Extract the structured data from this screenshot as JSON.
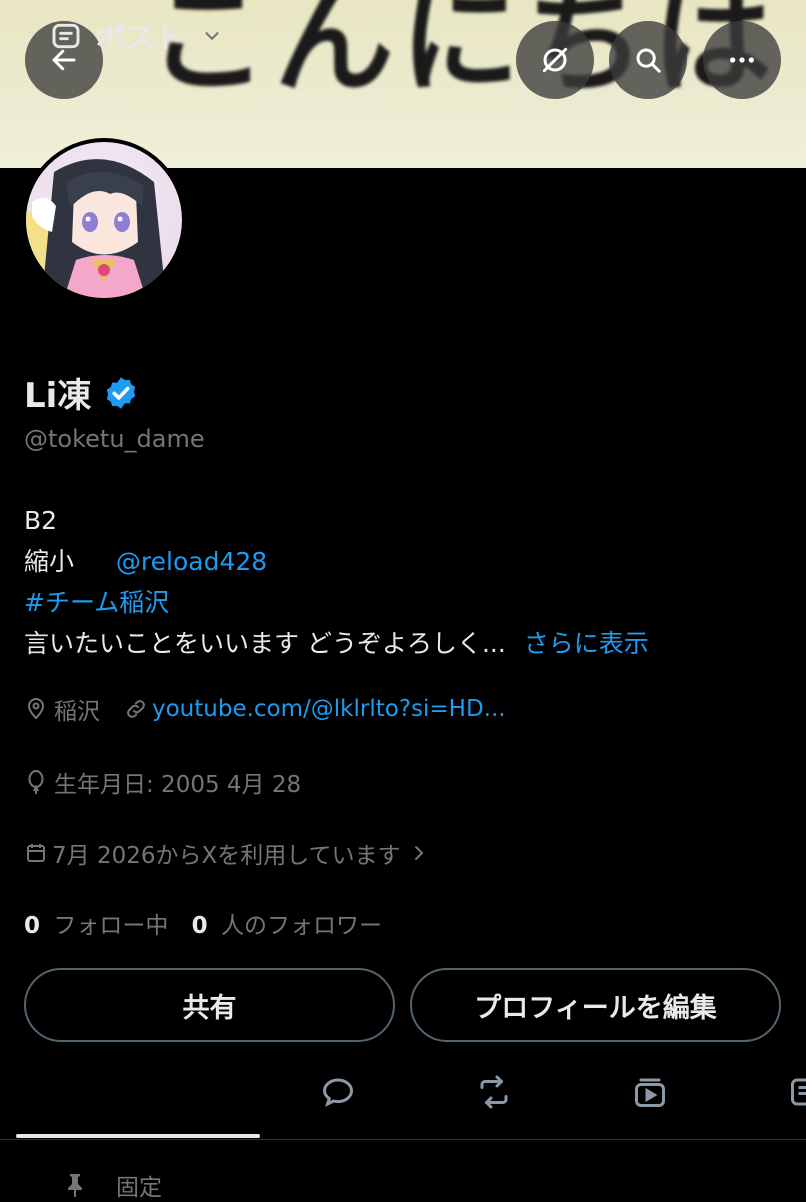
{
  "banner": {
    "text": "こんにちは",
    "bg_color": "#ecebd0"
  },
  "header_buttons": {
    "back_icon": "arrow-left-icon",
    "grok_icon": "grok-icon",
    "search_icon": "search-icon",
    "more_icon": "more-horizontal-icon"
  },
  "profile": {
    "name": "Li凍",
    "verified_icon": "verified-badge-icon",
    "handle": "@toketu_dame",
    "bio": {
      "line1": "B2",
      "line2_prefix": "縮小",
      "line2_mention": "@reload428",
      "hashtag": "#チーム稲沢",
      "line4_text": "言いたいことをいいます どうぞよろしく...",
      "show_more": "さらに表示"
    },
    "location": "稲沢",
    "link": "youtube.com/@lklrlto?si=HD...",
    "birthday": "生年月日: 2005 4月 28",
    "joined": "7月 2026からXを利用しています",
    "following_count": "0",
    "following_label": "フォロー中",
    "followers_count": "0",
    "followers_label": "人のフォロワー"
  },
  "actions": {
    "share": "共有",
    "edit_profile": "プロフィールを編集"
  },
  "tabs": {
    "active_label": "ポスト"
  },
  "pinned": {
    "label": "固定"
  },
  "colors": {
    "accent": "#1d9bf0",
    "text": "#e7e9ea",
    "muted": "#71767b",
    "background": "#000000"
  }
}
